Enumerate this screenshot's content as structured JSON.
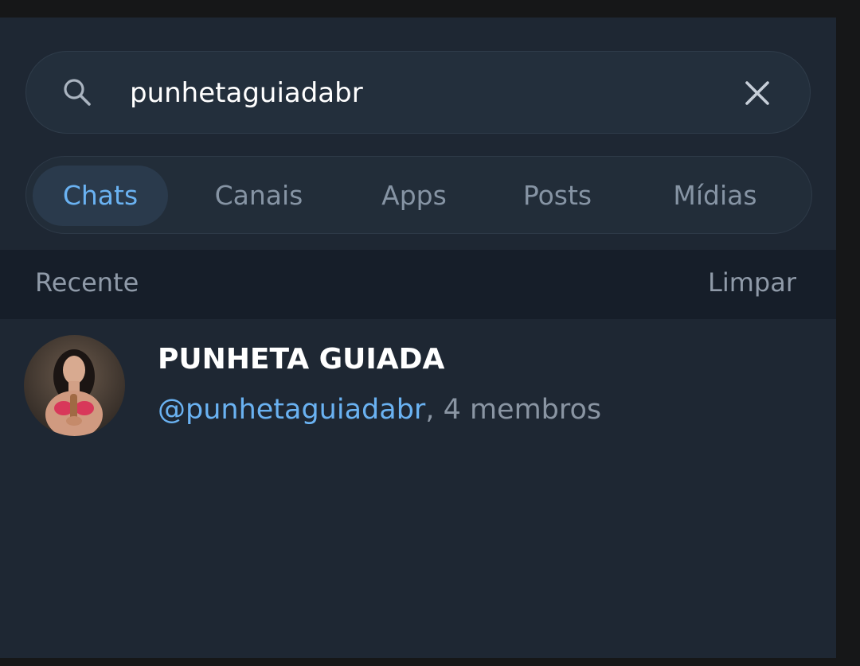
{
  "search": {
    "value": "punhetaguiadabr",
    "icon": "search-icon",
    "clear_icon": "close-icon"
  },
  "tabs": [
    {
      "label": "Chats",
      "active": true
    },
    {
      "label": "Canais",
      "active": false
    },
    {
      "label": "Apps",
      "active": false
    },
    {
      "label": "Posts",
      "active": false
    },
    {
      "label": "Mídias",
      "active": false
    }
  ],
  "recent": {
    "label": "Recente",
    "clear_label": "Limpar"
  },
  "results": [
    {
      "name": "PUNHETA GUIADA",
      "handle": "@punhetaguiadabr",
      "members": ", 4 membros"
    }
  ],
  "colors": {
    "background": "#1e2733",
    "accent": "#6ab2f2",
    "muted_text": "#8694a4",
    "header_band": "#161e29"
  }
}
